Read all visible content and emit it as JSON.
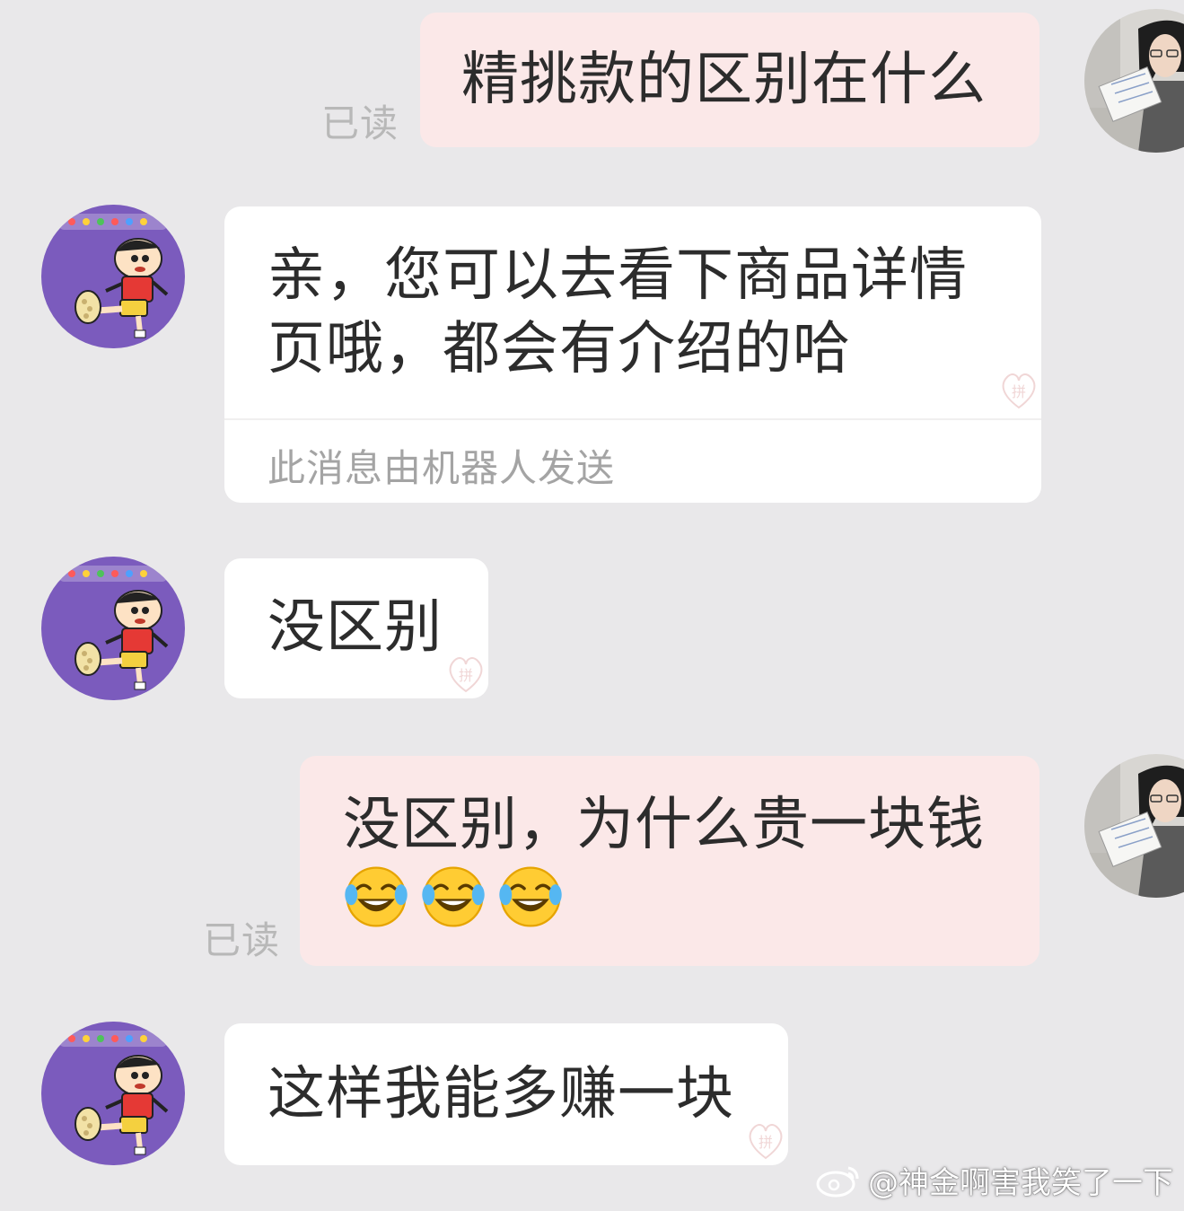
{
  "colors": {
    "background": "#e9e8ea",
    "mine_bubble": "#fbe8e8",
    "their_bubble": "#ffffff",
    "read_tag": "#b8b8b8",
    "bot_note": "#a4a4a4",
    "their_avatar_bg": "#7b5bbd"
  },
  "messages": [
    {
      "sender": "me",
      "avatar_icon": "girl-reading-avatar-icon",
      "text": "精挑款的区别在什么",
      "read_status": "已读"
    },
    {
      "sender": "seller",
      "avatar_icon": "cartoon-boy-avatar-icon",
      "text": "亲，您可以去看下商品详情\n页哦，都会有介绍的哈",
      "bot_note": "此消息由机器人发送"
    },
    {
      "sender": "seller",
      "avatar_icon": "cartoon-boy-avatar-icon",
      "text": "没区别"
    },
    {
      "sender": "me",
      "avatar_icon": "girl-reading-avatar-icon",
      "text": "没区别，为什么贵一块钱",
      "emoji": [
        "tears-of-joy-icon",
        "tears-of-joy-icon",
        "tears-of-joy-icon"
      ],
      "read_status": "已读"
    },
    {
      "sender": "seller",
      "avatar_icon": "cartoon-boy-avatar-icon",
      "text": "这样我能多赚一块"
    }
  ],
  "watermark": {
    "icon": "weibo-logo-icon",
    "text": "@神金啊害我笑了一下"
  }
}
